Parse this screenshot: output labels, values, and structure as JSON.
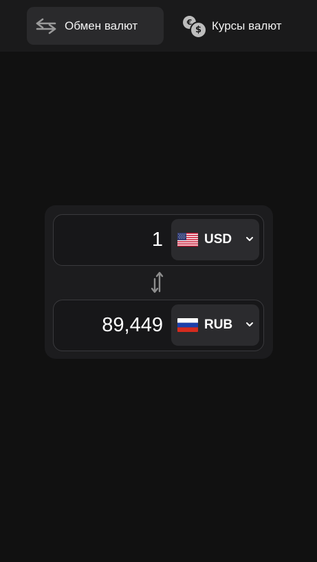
{
  "nav": {
    "tabs": [
      {
        "label": "Обмен валют",
        "icon": "exchange-arrows-icon",
        "active": true
      },
      {
        "label": "Курсы валют",
        "icon": "currency-coins-icon",
        "active": false
      }
    ],
    "coin_symbols": {
      "euro": "€",
      "dollar": "$"
    }
  },
  "converter": {
    "from": {
      "amount": "1",
      "currency": "USD",
      "flag": "us-flag-icon"
    },
    "to": {
      "amount": "89,449",
      "currency": "RUB",
      "flag": "ru-flag-icon"
    },
    "swap_icon": "swap-vertical-icon"
  },
  "colors": {
    "background": "#111111",
    "topbar": "#1a1a1b",
    "active_tab": "#2a2a2c",
    "panel": "#1c1c1e",
    "currency_button": "#2b2b2e",
    "text": "#ffffff"
  }
}
